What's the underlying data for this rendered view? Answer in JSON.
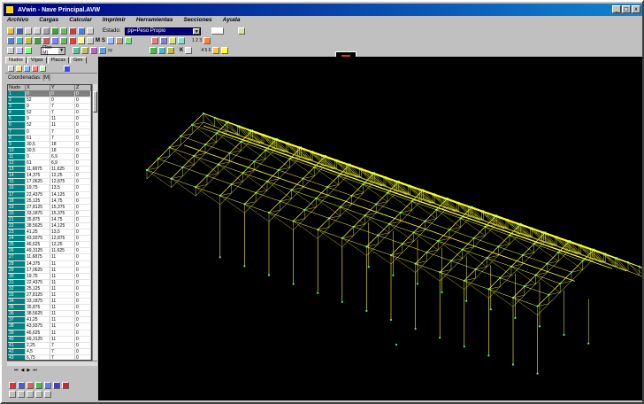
{
  "window": {
    "title": "AVwin - Nave Principal.AVW",
    "buttons": [
      "_",
      "□",
      "x"
    ]
  },
  "menu": [
    "Archivo",
    "Cargas",
    "Calcular",
    "Imprimir",
    "Herramientas",
    "Secciones",
    "Ayuda"
  ],
  "toolbar": {
    "estado_label": "Estado:",
    "estado_value": "pp=Peso Propio",
    "units_value": "[Ton-M]",
    "label_M": "M",
    "label_S": "S",
    "label_xy": "xy",
    "label_K": "K",
    "label_123": "1 2 3",
    "label_456": "4 5 6"
  },
  "panel": {
    "tabs": [
      "Nudos",
      "Vigas",
      "Placas",
      "Gen"
    ],
    "coord_label": "Coordenadas: [M]",
    "columns": [
      "Nudo",
      "X",
      "Y",
      "Z"
    ],
    "rows": [
      [
        "1",
        "0",
        "0",
        "0"
      ],
      [
        "2",
        "52",
        "0",
        "0"
      ],
      [
        "3",
        "9",
        "7",
        "0"
      ],
      [
        "4",
        "52",
        "7",
        "0"
      ],
      [
        "5",
        "9",
        "11",
        "0"
      ],
      [
        "6",
        "52",
        "11",
        "0"
      ],
      [
        "7",
        "0",
        "7",
        "0"
      ],
      [
        "8",
        "61",
        "7",
        "0"
      ],
      [
        "9",
        "30,5",
        "18",
        "0"
      ],
      [
        "10",
        "30,5",
        "18",
        "0"
      ],
      [
        "11",
        "0",
        "6,9",
        "0"
      ],
      [
        "12",
        "61",
        "6,9",
        "0"
      ],
      [
        "13",
        "11,6875",
        "11,625",
        "0"
      ],
      [
        "14",
        "14,375",
        "12,25",
        "0"
      ],
      [
        "15",
        "17,0625",
        "12,875",
        "0"
      ],
      [
        "16",
        "19,75",
        "13,5",
        "0"
      ],
      [
        "17",
        "22,4375",
        "14,125",
        "0"
      ],
      [
        "18",
        "25,125",
        "14,75",
        "0"
      ],
      [
        "19",
        "27,8125",
        "15,375",
        "0"
      ],
      [
        "20",
        "33,1875",
        "15,375",
        "0"
      ],
      [
        "21",
        "35,875",
        "14,75",
        "0"
      ],
      [
        "22",
        "38,5625",
        "14,125",
        "0"
      ],
      [
        "23",
        "41,25",
        "13,5",
        "0"
      ],
      [
        "24",
        "43,9375",
        "12,875",
        "0"
      ],
      [
        "25",
        "46,625",
        "12,25",
        "0"
      ],
      [
        "26",
        "49,3125",
        "11,625",
        "0"
      ],
      [
        "27",
        "11,6875",
        "11",
        "0"
      ],
      [
        "28",
        "14,375",
        "11",
        "0"
      ],
      [
        "29",
        "17,0625",
        "11",
        "0"
      ],
      [
        "30",
        "19,75",
        "11",
        "0"
      ],
      [
        "31",
        "22,4375",
        "11",
        "0"
      ],
      [
        "32",
        "25,125",
        "11",
        "0"
      ],
      [
        "33",
        "27,8125",
        "11",
        "0"
      ],
      [
        "34",
        "33,1875",
        "11",
        "0"
      ],
      [
        "35",
        "35,875",
        "11",
        "0"
      ],
      [
        "36",
        "38,5625",
        "11",
        "0"
      ],
      [
        "37",
        "41,25",
        "11",
        "0"
      ],
      [
        "38",
        "43,9375",
        "11",
        "0"
      ],
      [
        "39",
        "46,625",
        "11",
        "0"
      ],
      [
        "40",
        "49,3125",
        "11",
        "0"
      ],
      [
        "41",
        "2,25",
        "7",
        "0"
      ],
      [
        "42",
        "4,5",
        "7",
        "0"
      ],
      [
        "43",
        "6,75",
        "7",
        "0"
      ]
    ]
  },
  "colors": {
    "title_start": "#000080",
    "title_end": "#1084d0",
    "structure": "#ffff33",
    "node": "#33ff99",
    "nudo_column": "#008080",
    "viewport_bg": "#000000"
  }
}
